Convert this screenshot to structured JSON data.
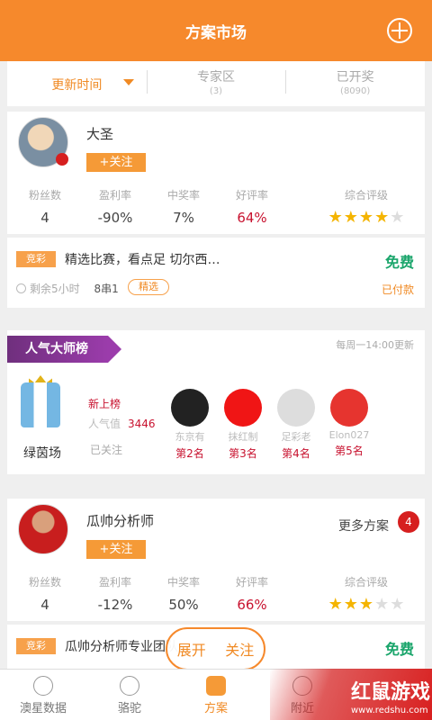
{
  "header": {
    "title": "方案市场",
    "menu_icon": "grid-icon"
  },
  "filters": [
    {
      "label": "更新时间",
      "sub": "",
      "active": true
    },
    {
      "label": "专家区",
      "sub": "(3)",
      "active": false
    },
    {
      "label": "已开奖",
      "sub": "(8090)",
      "active": false
    }
  ],
  "expert1": {
    "name": "大圣",
    "follow": "+关注",
    "stats": [
      {
        "k": "粉丝数",
        "v": "4"
      },
      {
        "k": "盈利率",
        "v": "-90%"
      },
      {
        "k": "中奖率",
        "v": "7%"
      },
      {
        "k": "好评率",
        "v": "64%"
      },
      {
        "k": "综合评级",
        "rating": 4,
        "max": 5
      }
    ],
    "plan": {
      "tag": "竞彩",
      "title": "精选比赛，看点足 切尔西…",
      "price": "免费",
      "remaining": "剩余5小时",
      "type": "8串1",
      "badge": "精选",
      "status": "已付款"
    }
  },
  "ranking": {
    "title": "人气大师榜",
    "update": "每周一14:00更新",
    "leader": {
      "name": "绿茵场",
      "new": "新上榜",
      "popularity_label": "人气值",
      "popularity": "3446",
      "followed": "已关注"
    },
    "items": [
      {
        "name": "东京有",
        "place": "第2名"
      },
      {
        "name": "抹红制",
        "place": "第3名"
      },
      {
        "name": "足彩老",
        "place": "第4名"
      },
      {
        "name": "Elon027",
        "place": "第5名"
      }
    ]
  },
  "expert2": {
    "name": "瓜帅分析师",
    "follow": "+关注",
    "more": "更多方案",
    "count": "4",
    "stats": [
      {
        "k": "粉丝数",
        "v": "4"
      },
      {
        "k": "盈利率",
        "v": "-12%"
      },
      {
        "k": "中奖率",
        "v": "50%"
      },
      {
        "k": "好评率",
        "v": "66%"
      },
      {
        "k": "综合评级",
        "rating": 3,
        "max": 5
      }
    ],
    "plan": {
      "tag": "竞彩",
      "title": "瓜帅分析师专业团队",
      "price": "免费"
    }
  },
  "floating": {
    "expand": "展开",
    "follow": "关注"
  },
  "nav": [
    {
      "label": "澳星数据",
      "icon": "star-icon",
      "active": false
    },
    {
      "label": "骆驼",
      "icon": "camel-icon",
      "active": false
    },
    {
      "label": "方案",
      "icon": "plan-icon",
      "active": true
    },
    {
      "label": "附近",
      "icon": "location-icon",
      "active": false
    }
  ],
  "watermark": {
    "brand": "红鼠游戏",
    "url": "www.redshu.com"
  }
}
